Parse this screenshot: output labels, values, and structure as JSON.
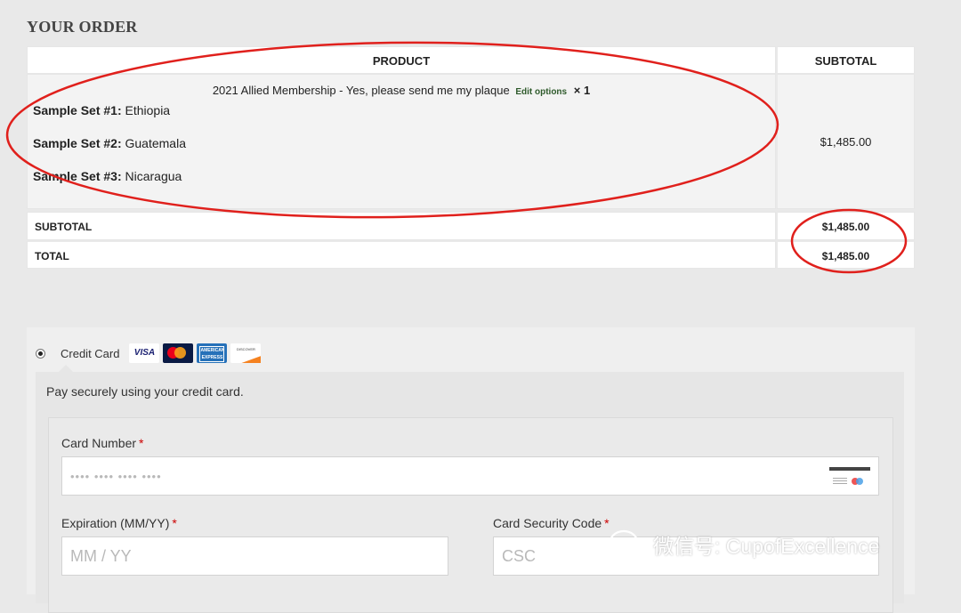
{
  "order": {
    "title": "YOUR ORDER",
    "columns": {
      "product": "PRODUCT",
      "subtotal": "SUBTOTAL"
    },
    "item": {
      "name": "2021 Allied Membership - Yes, please send me my plaque",
      "edit_link": "Edit options",
      "quantity": "× 1",
      "samples": [
        {
          "label": "Sample Set #1:",
          "value": "Ethiopia"
        },
        {
          "label": "Sample Set #2:",
          "value": "Guatemala"
        },
        {
          "label": "Sample Set #3:",
          "value": "Nicaragua"
        }
      ],
      "line_total": "$1,485.00"
    },
    "totals": [
      {
        "label": "SUBTOTAL",
        "value": "$1,485.00"
      },
      {
        "label": "TOTAL",
        "value": "$1,485.00"
      }
    ]
  },
  "payment": {
    "method_label": "Credit Card",
    "card_brands": [
      "VISA",
      "mastercard",
      "AMERICAN EXPRESS",
      "DISCOVER"
    ],
    "description": "Pay securely using your credit card.",
    "fields": {
      "card_number": {
        "label": "Card Number",
        "placeholder": "•••• •••• •••• ••••"
      },
      "expiration": {
        "label": "Expiration (MM/YY)",
        "placeholder": "MM / YY"
      },
      "csc": {
        "label": "Card Security Code",
        "placeholder": "CSC"
      }
    },
    "required_mark": "*"
  },
  "watermark": {
    "text": "微信号: CupofExcellence"
  },
  "annotation_color": "#e0201c"
}
